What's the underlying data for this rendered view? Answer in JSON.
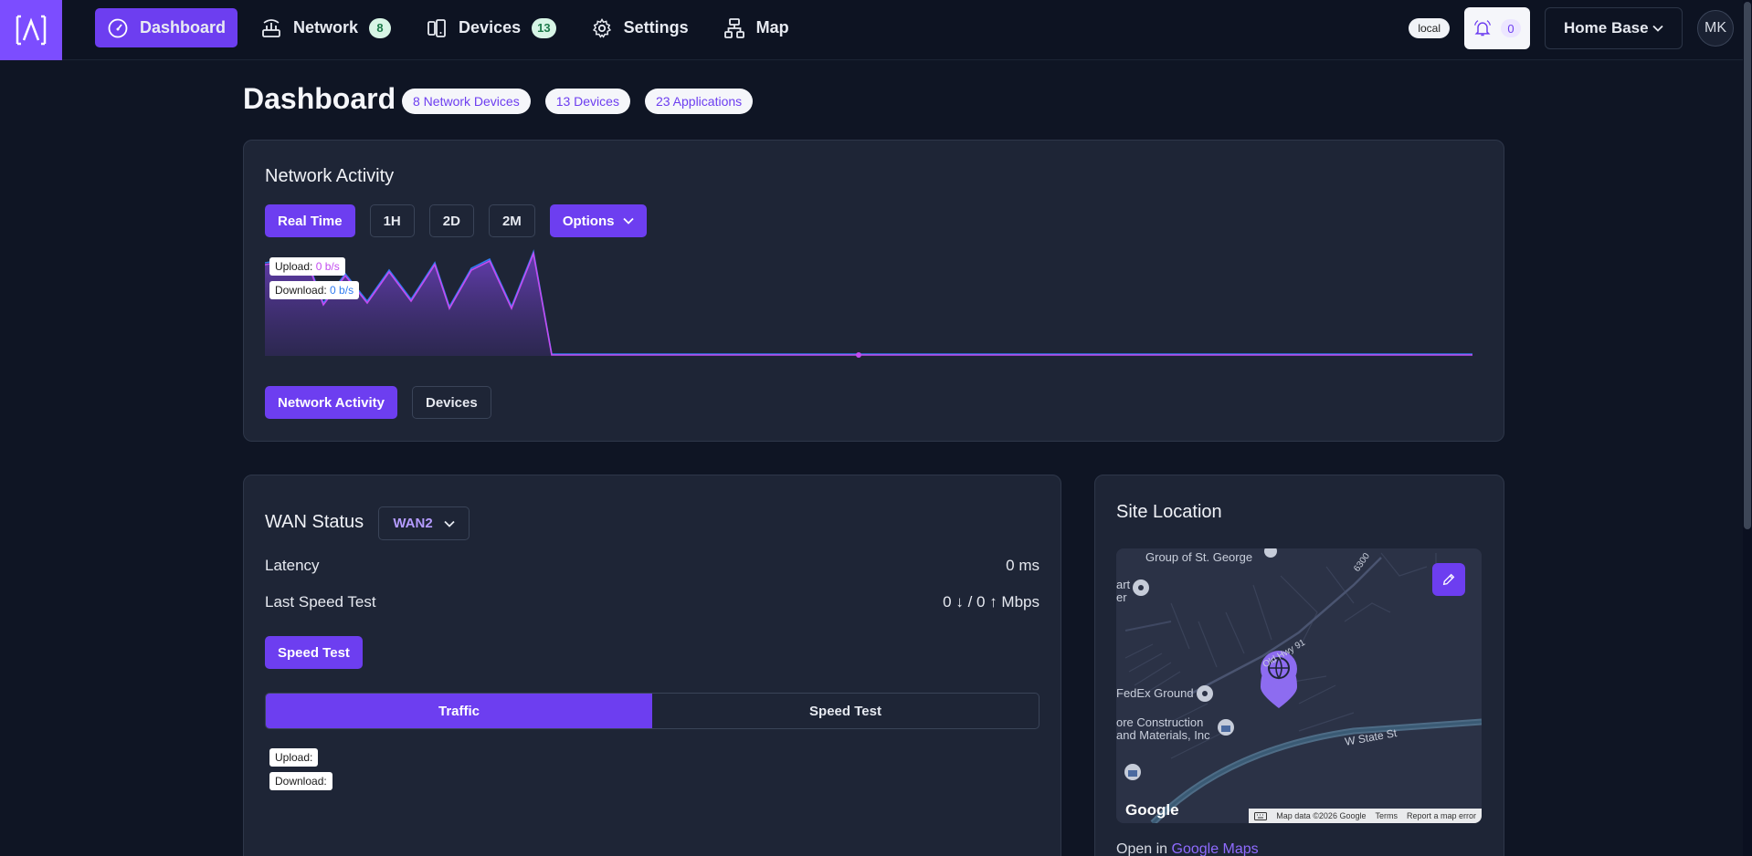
{
  "nav": {
    "items": [
      {
        "label": "Dashboard",
        "icon": "gauge-icon",
        "active": true
      },
      {
        "label": "Network",
        "icon": "router-icon",
        "count": "8"
      },
      {
        "label": "Devices",
        "icon": "devices-icon",
        "count": "13"
      },
      {
        "label": "Settings",
        "icon": "gear-icon"
      },
      {
        "label": "Map",
        "icon": "sitemap-icon"
      }
    ],
    "env_badge": "local",
    "notifications_count": "0",
    "site": "Home Base",
    "avatar_initials": "MK"
  },
  "page": {
    "title": "Dashboard",
    "pills": [
      "8 Network Devices",
      "13 Devices",
      "23 Applications"
    ]
  },
  "network_activity": {
    "title": "Network Activity",
    "ranges": [
      "Real Time",
      "1H",
      "2D",
      "2M"
    ],
    "options_label": "Options",
    "tooltip": {
      "upload_label": "Upload:",
      "upload_value": "0 b/s",
      "download_label": "Download:",
      "download_value": "0 b/s"
    },
    "tabs": [
      "Network Activity",
      "Devices"
    ]
  },
  "wan": {
    "title": "WAN Status",
    "selected": "WAN2",
    "latency_label": "Latency",
    "latency_value": "0 ms",
    "speed_label": "Last Speed Test",
    "speed_value": "0 ↓ / 0 ↑ Mbps",
    "speed_test_button": "Speed Test",
    "tabs": [
      "Traffic",
      "Speed Test"
    ],
    "upload_label": "Upload:",
    "download_label": "Download:"
  },
  "site_location": {
    "title": "Site Location",
    "map_labels": {
      "place1": "Group of St. George",
      "place2": "FedEx Ground",
      "place3a": "ore Construction",
      "place3b": "and Materials, Inc",
      "road1": "Old Hwy 91",
      "road2": "W State St",
      "road3": "6300",
      "frag1": "art",
      "frag2": "er"
    },
    "map_footer": [
      "Map data ©2026 Google",
      "Terms",
      "Report a map error"
    ],
    "google": "Google",
    "open_prefix": "Open in",
    "open_link": "Google Maps"
  },
  "colors": {
    "accent": "#6d3ef0",
    "upload": "#c34cf0",
    "download": "#2f7bf0"
  }
}
